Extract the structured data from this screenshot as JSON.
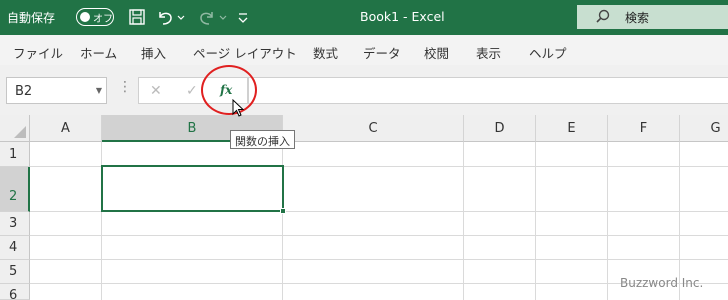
{
  "titlebar": {
    "autosave_label": "自動保存",
    "autosave_state": "オフ",
    "title": "Book1  -  Excel",
    "search_placeholder": "検索",
    "icons": [
      "save-icon",
      "undo-icon",
      "redo-icon",
      "customize-qat-icon",
      "search-icon"
    ]
  },
  "ribbon": {
    "tabs": [
      "ファイル",
      "ホーム",
      "挿入",
      "ページ レイアウト",
      "数式",
      "データ",
      "校閲",
      "表示",
      "ヘルプ"
    ]
  },
  "formula_bar": {
    "name_box": "B2",
    "insert_function_symbol": "fx",
    "formula": ""
  },
  "grid": {
    "columns": [
      "A",
      "B",
      "C",
      "D",
      "E",
      "F",
      "G"
    ],
    "rows": [
      "1",
      "2",
      "3",
      "4",
      "5",
      "6"
    ],
    "selected_cell": "B2"
  },
  "tooltip": "関数の挿入",
  "watermark": "Buzzword Inc.",
  "colors": {
    "excel_green": "#217346",
    "highlight_red": "#e02020"
  }
}
